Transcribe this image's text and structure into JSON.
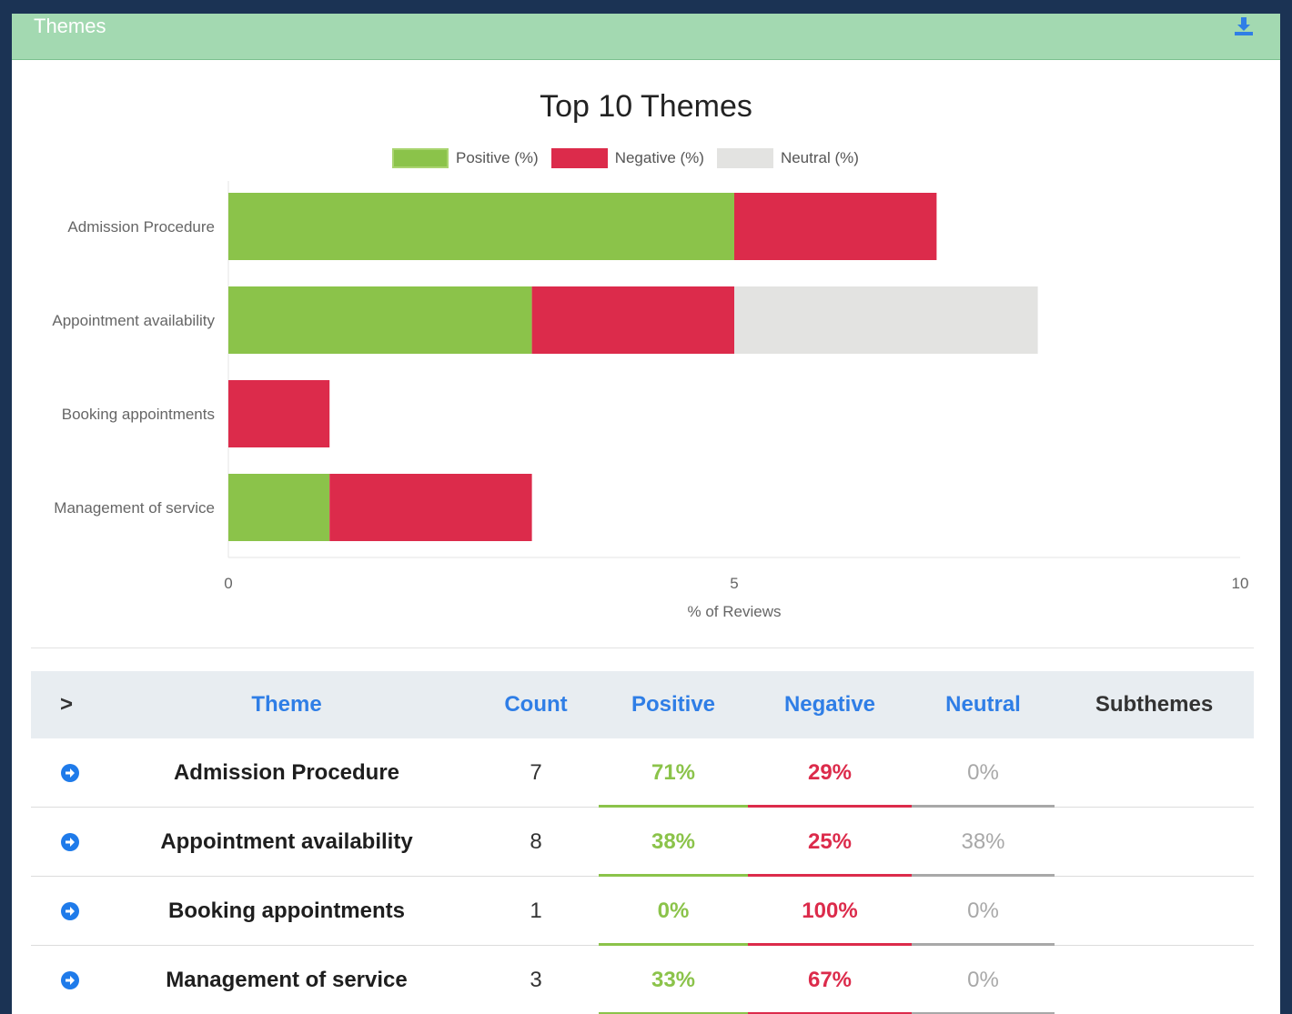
{
  "panel": {
    "title": "Themes",
    "download_icon": "download-icon",
    "header_color": "#a3d9b1"
  },
  "chart_data": {
    "type": "bar",
    "orientation": "horizontal",
    "stacked": true,
    "title": "Top 10 Themes",
    "categories": [
      "Admission Procedure",
      "Appointment availability",
      "Booking appointments",
      "Management of service"
    ],
    "series": [
      {
        "name": "Positive (%)",
        "color": "#8bc34a",
        "values": [
          5,
          3,
          0,
          1
        ]
      },
      {
        "name": "Negative (%)",
        "color": "#dc2b4b",
        "values": [
          2,
          2,
          1,
          2
        ]
      },
      {
        "name": "Neutral (%)",
        "color": "#e3e3e1",
        "values": [
          0,
          3,
          0,
          0
        ]
      }
    ],
    "xlabel": "% of Reviews",
    "ylabel": "",
    "xlim": [
      0,
      10
    ],
    "xticks": [
      "0",
      "5",
      "10"
    ],
    "legend": "top",
    "grid": false
  },
  "table": {
    "headers": {
      "expand": ">",
      "theme": "Theme",
      "count": "Count",
      "positive": "Positive",
      "negative": "Negative",
      "neutral": "Neutral",
      "subthemes": "Subthemes"
    },
    "rows": [
      {
        "theme": "Admission Procedure",
        "count": "7",
        "positive": "71%",
        "negative": "29%",
        "neutral": "0%",
        "icon": "arrow-circle-right-icon"
      },
      {
        "theme": "Appointment availability",
        "count": "8",
        "positive": "38%",
        "negative": "25%",
        "neutral": "38%",
        "icon": "arrow-circle-right-icon"
      },
      {
        "theme": "Booking appointments",
        "count": "1",
        "positive": "0%",
        "negative": "100%",
        "neutral": "0%",
        "icon": "arrow-circle-right-icon"
      },
      {
        "theme": "Management of service",
        "count": "3",
        "positive": "33%",
        "negative": "67%",
        "neutral": "0%",
        "icon": "arrow-circle-right-icon"
      }
    ],
    "colors": {
      "positive": "#8bc34a",
      "negative": "#dc2b4b",
      "neutral": "#a8a8a8",
      "link": "#2f7ee6"
    }
  }
}
